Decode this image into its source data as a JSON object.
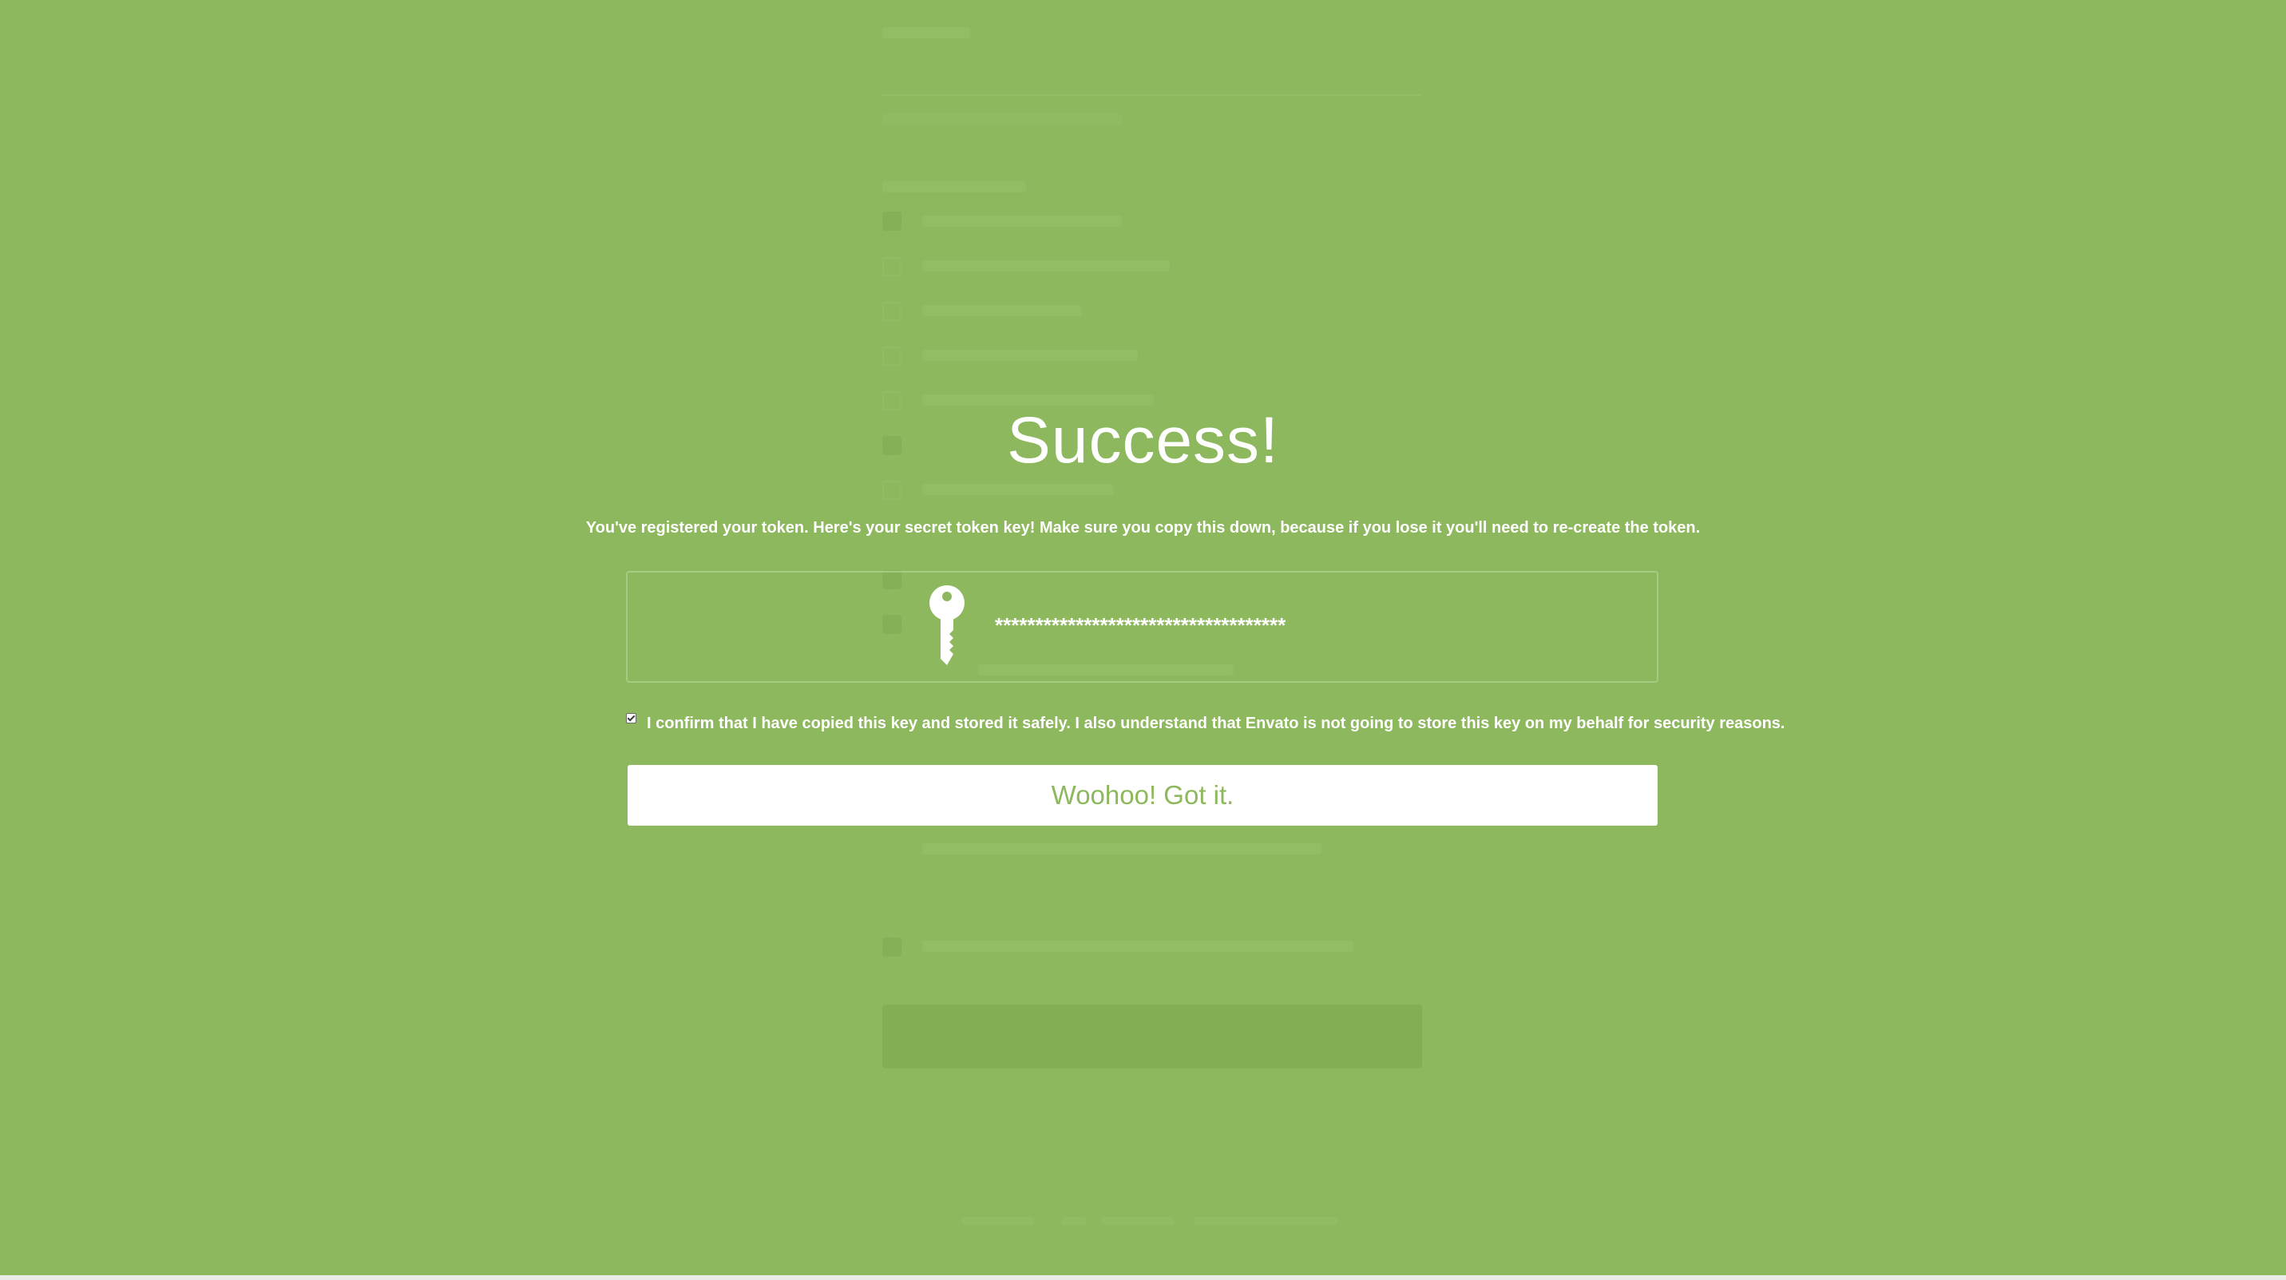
{
  "modal": {
    "title": "Success!",
    "message": "You've registered your token. Here's your secret token key! Make sure you copy this down, because if you lose it you'll need to re-create the token.",
    "token_key": "************************************",
    "confirm_label": "I confirm that I have copied this key and stored it safely. I also understand that Envato is not going to store this key on my behalf for security reasons.",
    "confirm_checked": true,
    "button_label": "Woohoo! Got it."
  },
  "icons": {
    "key": "key-icon",
    "checkbox": "checkbox-checked"
  },
  "colors": {
    "background": "#8db85d",
    "button_background": "#ffffff",
    "button_text": "#8db85d",
    "text": "#ffffff"
  }
}
